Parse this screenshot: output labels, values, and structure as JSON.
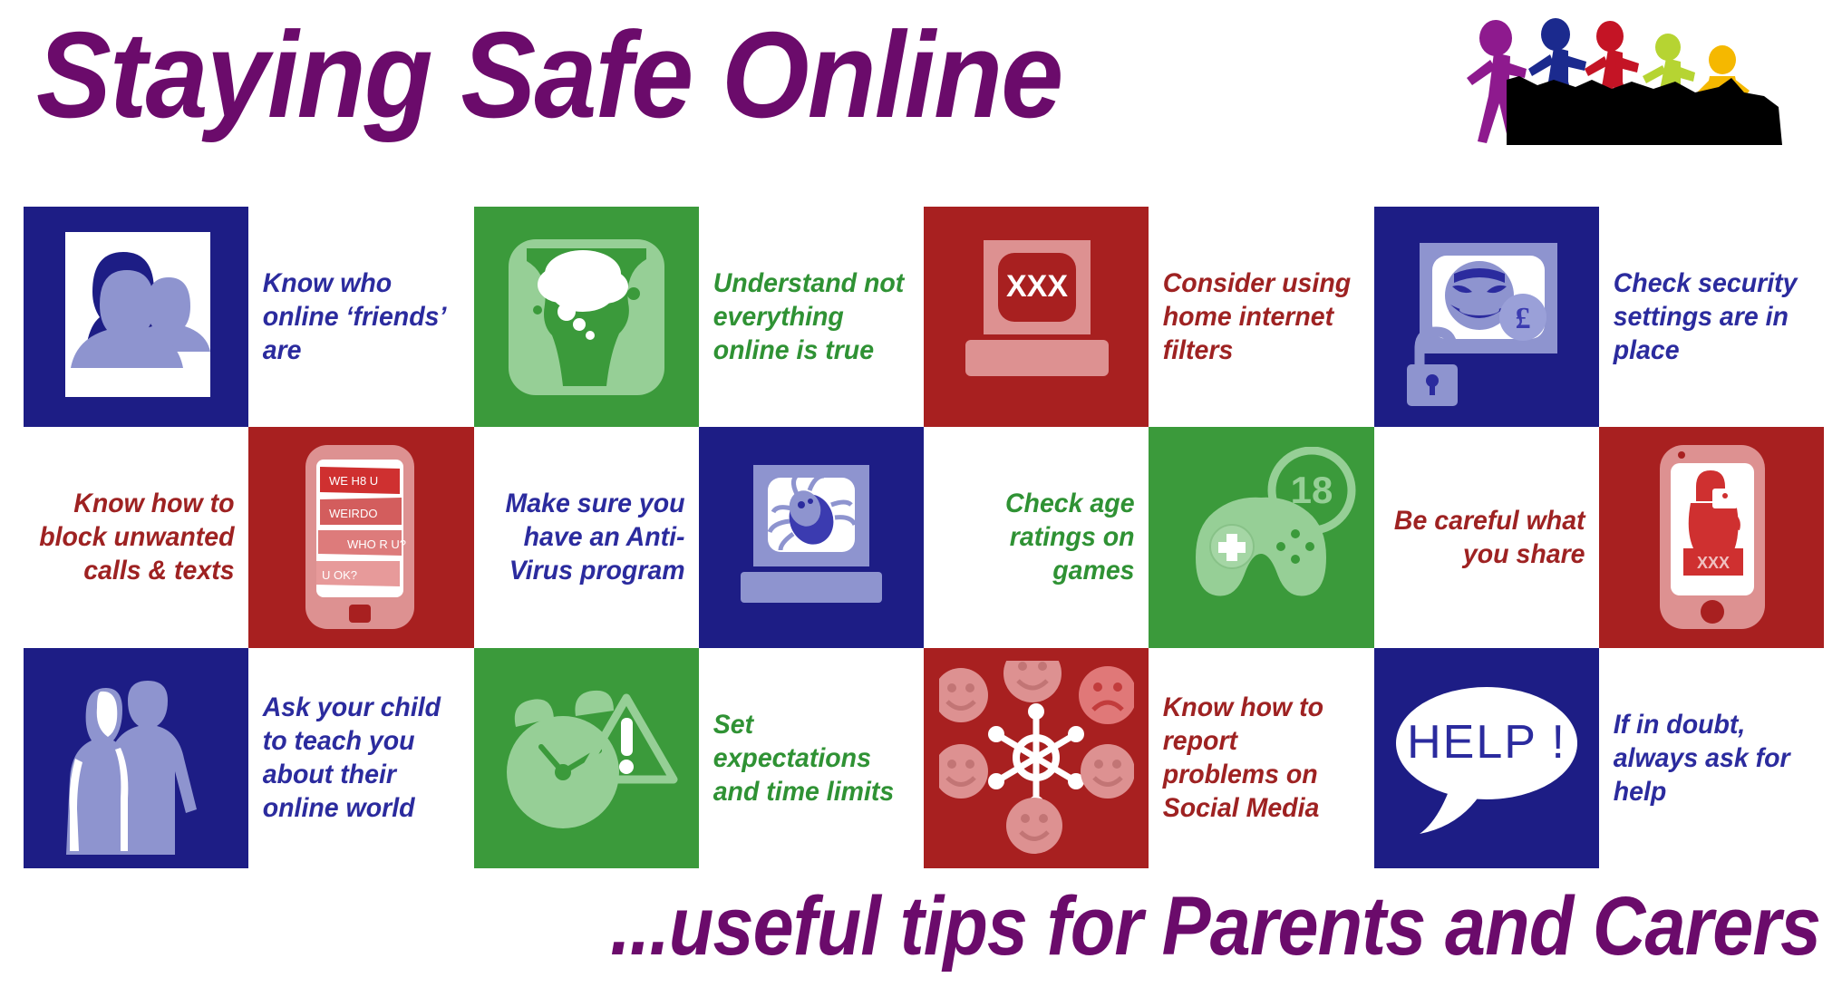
{
  "header": {
    "title": "Staying Safe Online",
    "logo": {
      "name": "colourful-running-figures-logo",
      "figure_colors": [
        "#8e1a8e",
        "#1b2a8e",
        "#c41425",
        "#b6d432",
        "#f5b800"
      ]
    }
  },
  "colors": {
    "title_purple": "#6b0b6b",
    "tile_blue": "#1d1d85",
    "tile_green": "#3b9a3b",
    "tile_red": "#a82020",
    "text_blue": "#2b2b9e",
    "text_green": "#2f9234",
    "text_red": "#9e2222"
  },
  "tips": [
    {
      "id": 1,
      "text": "Know who online ‘friends’ are",
      "theme": "blue",
      "icon": "two-people-silhouette-icon",
      "layout": "image-left"
    },
    {
      "id": 2,
      "text": "Understand not everything online is true",
      "theme": "green",
      "icon": "two-faces-thought-bubble-icon",
      "layout": "image-left"
    },
    {
      "id": 3,
      "text": "Consider using home internet filters",
      "theme": "red",
      "icon": "monitor-xxx-icon",
      "layout": "image-left"
    },
    {
      "id": 4,
      "text": "Check security settings are in place",
      "theme": "blue",
      "icon": "monitor-evil-face-padlock-icon",
      "layout": "image-left"
    },
    {
      "id": 5,
      "text": "Know how to block unwanted calls & texts",
      "theme": "red",
      "icon": "phone-abusive-texts-icon",
      "layout": "image-right"
    },
    {
      "id": 6,
      "text": "Make sure you have an Anti-Virus program",
      "theme": "blue",
      "icon": "monitor-virus-bug-icon",
      "layout": "image-right"
    },
    {
      "id": 7,
      "text": "Check age ratings on games",
      "theme": "green",
      "icon": "game-controller-18-rating-icon",
      "layout": "image-right"
    },
    {
      "id": 8,
      "text": "Be careful what you share",
      "theme": "red",
      "icon": "phone-selfie-xxx-icon",
      "layout": "image-right"
    },
    {
      "id": 9,
      "text": "Ask your child to teach you about their online world",
      "theme": "blue",
      "icon": "parent-and-child-silhouette-icon",
      "layout": "image-left"
    },
    {
      "id": 10,
      "text": "Set expectations and time limits",
      "theme": "green",
      "icon": "alarm-clock-warning-icon",
      "layout": "image-left"
    },
    {
      "id": 11,
      "text": "Know how to report problems on Social Media",
      "theme": "red",
      "icon": "social-network-faces-icon",
      "layout": "image-left"
    },
    {
      "id": 12,
      "text": "If in doubt, always ask for help",
      "theme": "blue",
      "icon": "help-speech-bubble-icon",
      "layout": "image-left"
    }
  ],
  "icon_labels": {
    "monitor_xxx": "XXX",
    "phone_xxx": "XXX",
    "pound_symbol": "£",
    "age_rating": "18",
    "help_bubble": "HELP !",
    "warning_mark": "!",
    "phone_texts": [
      "WE H8 U",
      "WEIRDO",
      "WHO  R U?",
      "U OK?"
    ]
  },
  "footer": {
    "tagline": "...useful tips for Parents and Carers"
  }
}
